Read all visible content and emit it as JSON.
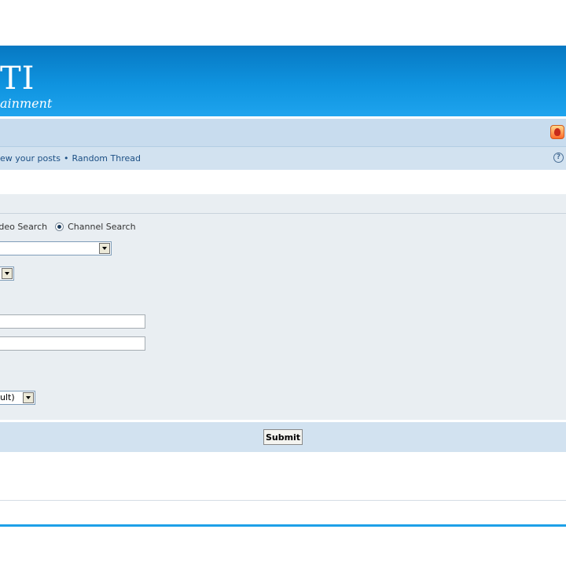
{
  "banner": {
    "logo_text": "TI",
    "logo_tagline": "ainment"
  },
  "linkbar": {
    "links": [
      "ew your posts",
      "Random Thread"
    ],
    "separator": "•",
    "help_icon": "?"
  },
  "search_form": {
    "search_types": [
      {
        "label": "Video Search",
        "checked": false
      },
      {
        "label": "Channel Search",
        "checked": true
      }
    ],
    "sort_select_value": "ult)",
    "submit_label": "Submit"
  },
  "colors": {
    "banner_top": "#0778c2",
    "banner_bottom": "#1ea4ee",
    "navbar": "#c8dcee",
    "form_bg": "#e9eef2",
    "link": "#1c4f84"
  }
}
